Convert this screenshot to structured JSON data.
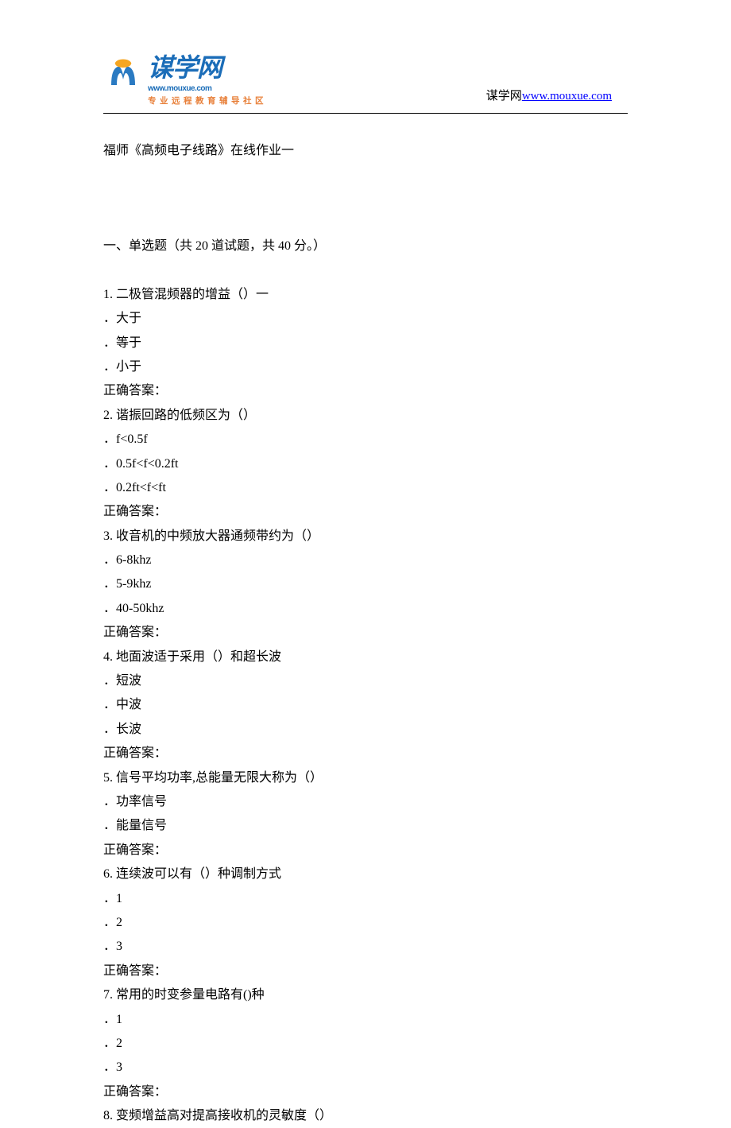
{
  "header": {
    "logo_chinese": "谋学网",
    "logo_url_small": "www.mouxue.com",
    "logo_tagline": "专业远程教育辅导社区",
    "right_text": "谋学网",
    "right_link": "www.mouxue.com"
  },
  "doc": {
    "title": "福师《高频电子线路》在线作业一",
    "section_title": "一、单选题（共 20 道试题，共 40 分。）"
  },
  "questions": [
    {
      "num": "1.",
      "text": "二极管混频器的增益（）一",
      "options": [
        "．大于",
        "．等于",
        "．小于"
      ],
      "answer_label": "正确答案："
    },
    {
      "num": "2.",
      "text": "谐振回路的低频区为（）",
      "options": [
        "．f<0.5f",
        "．0.5f<f<0.2ft",
        "．0.2ft<f<ft"
      ],
      "answer_label": "正确答案："
    },
    {
      "num": "3.",
      "text": "收音机的中频放大器通频带约为（）",
      "options": [
        "．6-8khz",
        "．5-9khz",
        "．40-50khz"
      ],
      "answer_label": "正确答案："
    },
    {
      "num": "4.",
      "text": "地面波适于采用（）和超长波",
      "options": [
        "．短波",
        "．中波",
        "．长波"
      ],
      "answer_label": "正确答案："
    },
    {
      "num": "5.",
      "text": "信号平均功率,总能量无限大称为（）",
      "options": [
        "．功率信号",
        "．能量信号"
      ],
      "answer_label": "正确答案："
    },
    {
      "num": "6.",
      "text": "连续波可以有（）种调制方式",
      "options": [
        "．1",
        "．2",
        "．3"
      ],
      "answer_label": "正确答案："
    },
    {
      "num": "7.",
      "text": "常用的时变参量电路有()种",
      "options": [
        "．1",
        "．2",
        "．3"
      ],
      "answer_label": "正确答案："
    },
    {
      "num": "8.",
      "text": "变频增益高对提高接收机的灵敏度（）",
      "options": [],
      "answer_label": ""
    }
  ]
}
